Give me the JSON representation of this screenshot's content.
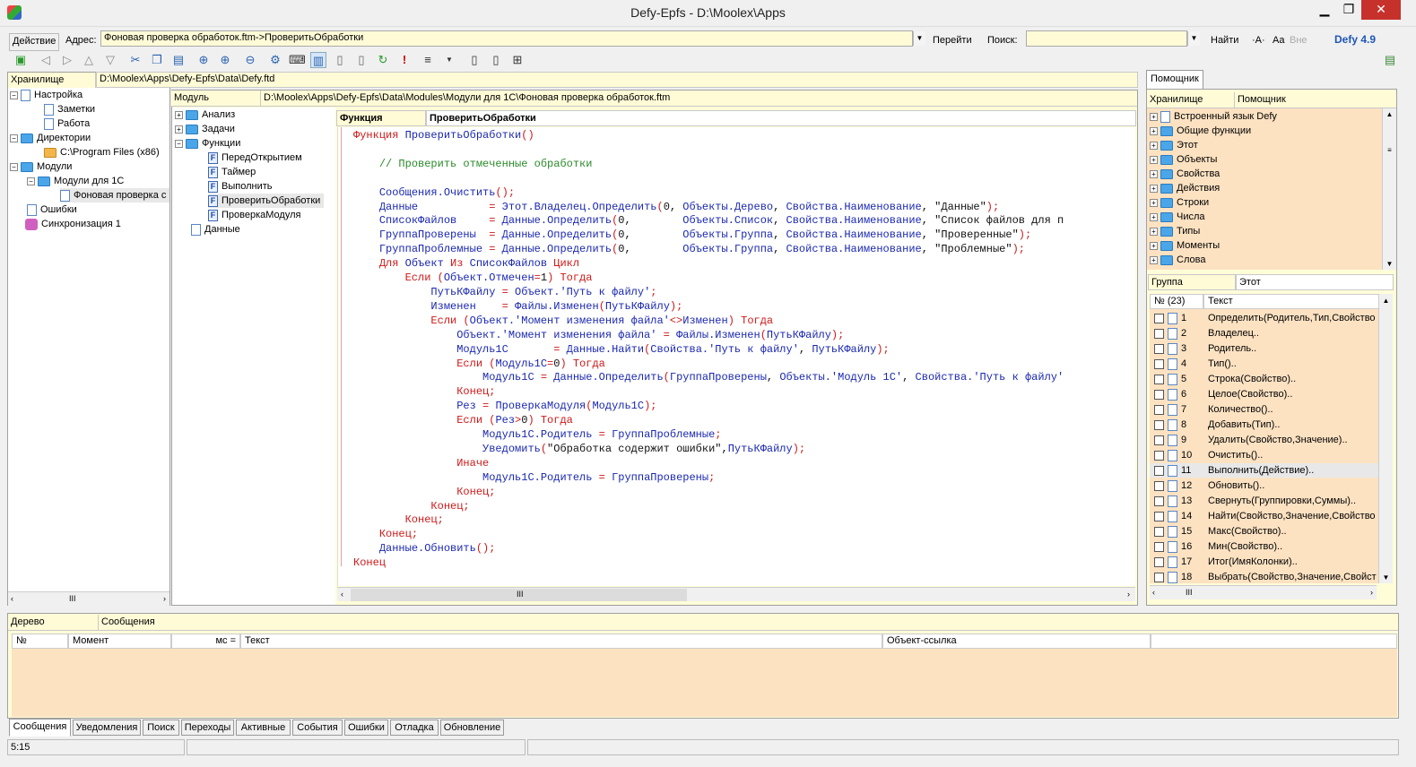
{
  "window": {
    "title": "Defy-Epfs - D:\\Moolex\\Apps"
  },
  "addressbar": {
    "action_label": "Действие",
    "address_label": "Адрес:",
    "address_value": "Фоновая проверка обработок.ftm->ПроверитьОбработки",
    "go_label": "Перейти",
    "search_label": "Поиск:",
    "search_value": "",
    "find_label": "Найти",
    "font_small": "·A·",
    "font_case": "Aa",
    "font_all": "Вне",
    "version": "Defy 4.9"
  },
  "storage": {
    "label": "Хранилище",
    "path": "D:\\Moolex\\Apps\\Defy-Epfs\\Data\\Defy.ftd",
    "tree": [
      "Настройка",
      "Заметки",
      "Работа",
      "Директории",
      "C:\\Program Files (x86)",
      "Модули",
      "Модули для 1С",
      "Фоновая проверка с",
      "Ошибки",
      "Синхронизация 1"
    ]
  },
  "module": {
    "label": "Модуль",
    "path": "D:\\Moolex\\Apps\\Defy-Epfs\\Data\\Modules\\Модули для 1С\\Фоновая проверка обработок.ftm",
    "tree": [
      "Анализ",
      "Задачи",
      "Функции",
      "ПередОткрытием",
      "Таймер",
      "Выполнить",
      "ПроверитьОбработки",
      "ПроверкаМодуля",
      "Данные"
    ]
  },
  "editor": {
    "func_label": "Функция",
    "func_name": "ПроверитьОбработки"
  },
  "helper": {
    "tab": "Помощник",
    "col_storage": "Хранилище",
    "col_helper": "Помощник",
    "items": [
      "Встроенный язык Defy",
      "Общие функции",
      "Этот",
      "Объекты",
      "Свойства",
      "Действия",
      "Строки",
      "Числа",
      "Типы",
      "Моменты",
      "Слова"
    ],
    "group_label": "Группа",
    "group_value": "Этот",
    "count_header": "№ (23)",
    "text_header": "Текст",
    "rows": [
      {
        "n": "1",
        "t": "Определить(Родитель,Тип,Свойство"
      },
      {
        "n": "2",
        "t": "Владелец.."
      },
      {
        "n": "3",
        "t": "Родитель.."
      },
      {
        "n": "4",
        "t": "Тип().."
      },
      {
        "n": "5",
        "t": "Строка(Свойство).."
      },
      {
        "n": "6",
        "t": "Целое(Свойство).."
      },
      {
        "n": "7",
        "t": "Количество().."
      },
      {
        "n": "8",
        "t": "Добавить(Тип).."
      },
      {
        "n": "9",
        "t": "Удалить(Свойство,Значение).."
      },
      {
        "n": "10",
        "t": "Очистить().."
      },
      {
        "n": "11",
        "t": "Выполнить(Действие).."
      },
      {
        "n": "12",
        "t": "Обновить().."
      },
      {
        "n": "13",
        "t": "Свернуть(Группировки,Суммы).."
      },
      {
        "n": "14",
        "t": "Найти(Свойство,Значение,Свойство"
      },
      {
        "n": "15",
        "t": "Макс(Свойство).."
      },
      {
        "n": "16",
        "t": "Мин(Свойство).."
      },
      {
        "n": "17",
        "t": "Итог(ИмяКолонки).."
      },
      {
        "n": "18",
        "t": "Выбрать(Свойство,Значение,Свойст"
      }
    ]
  },
  "bottom": {
    "tree_label": "Дерево",
    "messages_label": "Сообщения",
    "col_num": "№",
    "col_moment": "Момент",
    "col_ms": "мс =",
    "col_text": "Текст",
    "col_ref": "Объект-ссылка",
    "tabs": [
      "Сообщения",
      "Уведомления",
      "Поиск",
      "Переходы",
      "Активные",
      "События",
      "Ошибки",
      "Отладка",
      "Обновление"
    ]
  },
  "status": {
    "pos": "5:15"
  }
}
